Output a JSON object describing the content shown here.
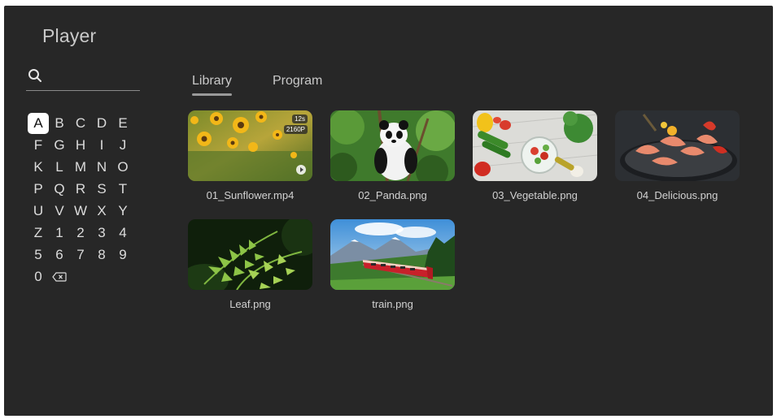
{
  "app": {
    "title": "Player"
  },
  "search": {
    "placeholder": ""
  },
  "keyboard": {
    "rows": [
      [
        "A",
        "B",
        "C",
        "D",
        "E"
      ],
      [
        "F",
        "G",
        "H",
        "I",
        "J"
      ],
      [
        "K",
        "L",
        "M",
        "N",
        "O"
      ],
      [
        "P",
        "Q",
        "R",
        "S",
        "T"
      ],
      [
        "U",
        "V",
        "W",
        "X",
        "Y"
      ],
      [
        "Z",
        "1",
        "2",
        "3",
        "4"
      ],
      [
        "5",
        "6",
        "7",
        "8",
        "9"
      ],
      [
        "0"
      ]
    ],
    "active_key": "A",
    "delete_icon": "backspace-icon"
  },
  "tabs": [
    {
      "label": "Library",
      "selected": true
    },
    {
      "label": "Program",
      "selected": false
    }
  ],
  "media": [
    {
      "name": "01_Sunflower.mp4",
      "duration": "12s",
      "resolution": "2160P",
      "type": "video"
    },
    {
      "name": "02_Panda.png",
      "type": "image"
    },
    {
      "name": "03_Vegetable.png",
      "type": "image"
    },
    {
      "name": "04_Delicious.png",
      "type": "image"
    },
    {
      "name": "Leaf.png",
      "type": "image"
    },
    {
      "name": "train.png",
      "type": "image"
    }
  ],
  "colors": {
    "background": "#272727",
    "accent": "#ffffff",
    "tab_underline": "#9a9a9a"
  }
}
